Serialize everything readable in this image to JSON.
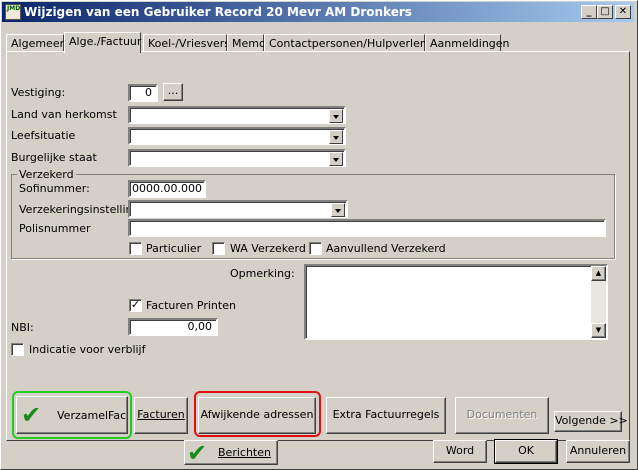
{
  "window": {
    "title": "Wijzigen van een Gebruiker Record 20 Mevr AM Dronkers",
    "app_icon_text": "JMD"
  },
  "tabs": [
    "Algemeen",
    "Alge./Factuur",
    "Koel-/Vriesvers",
    "Memo",
    "Contactpersonen/Hulpverleners",
    "Aanmeldingen"
  ],
  "form": {
    "vestiging_label": "Vestiging:",
    "vestiging_value": "0",
    "vestiging_browse": "...",
    "land_label": "Land van herkomst",
    "land_value": "",
    "leefsituatie_label": "Leefsituatie",
    "leefsituatie_value": "",
    "burgerlijke_label": "Burgelijke staat",
    "burgerlijke_value": "",
    "verzekerd_title": "Verzekerd",
    "sofi_label": "Sofinummer:",
    "sofi_value": "0000.00.000",
    "verzekering_label": "Verzekeringsinstelling:",
    "verzekering_value": "",
    "polis_label": "Polisnummer",
    "polis_value": "",
    "particulier_label": "Particulier",
    "particulier_checked": false,
    "wa_label": "WA Verzekerd",
    "wa_checked": false,
    "aanvullend_label": "Aanvullend Verzekerd",
    "aanvullend_checked": false,
    "opmerking_label": "Opmerking:",
    "opmerking_value": "",
    "facturen_printen_label": "Facturen Printen",
    "facturen_printen_checked": true,
    "facturen_printen_mark": "✓",
    "nbi_label": "NBI:",
    "nbi_value": "0,00",
    "indicatie_label": "Indicatie voor verblijf",
    "indicatie_checked": false
  },
  "buttons": {
    "verzamelfac": "VerzamelFac",
    "facturen": "Facturen",
    "afwijkende": "Afwijkende adressen",
    "extra": "Extra Factuurregels",
    "documenten": "Documenten",
    "volgende": "Volgende >>",
    "berichten": "Berichten",
    "word": "Word",
    "ok": "OK",
    "annuleren": "Annuleren"
  },
  "icons": {
    "checkmark": "✔"
  },
  "highlights": {
    "green": "#22cc22",
    "red": "#e01010"
  }
}
